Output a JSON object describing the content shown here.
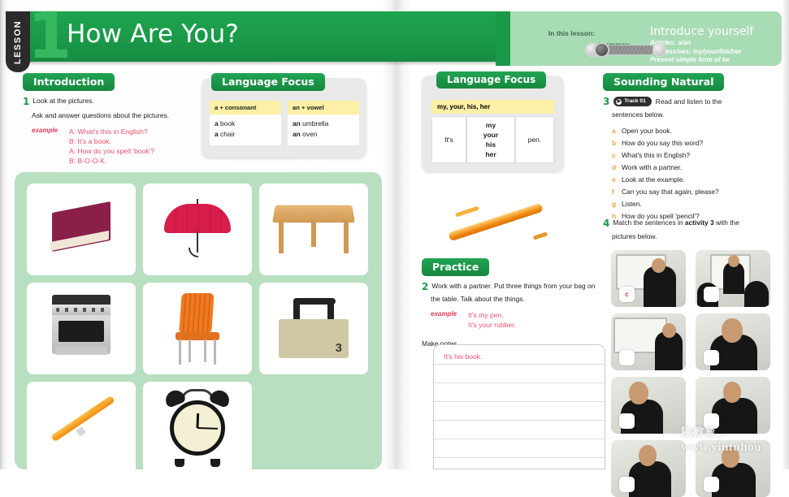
{
  "header": {
    "lesson_tab_label": "LESSON",
    "lesson_number": "1",
    "title": "How Are You?"
  },
  "info_box": {
    "in_this_lesson_label": "In this lesson:",
    "in_this_lesson_value": "Introduce yourself",
    "grammar_label": "Grammar:",
    "grammar_items": [
      "Articles: a/an",
      "Possessives: my/your/his/her",
      "Present simple form of be"
    ]
  },
  "introduction": {
    "heading": "Introduction",
    "number": "1",
    "line1": "Look at the pictures.",
    "line2": "Ask and answer questions about the pictures.",
    "example_label": "example",
    "dialog": [
      "A: What's this in English?",
      "B: It's a book.",
      "A: How do you spell 'book'?",
      "B: B-O-O-K."
    ]
  },
  "language_focus_1": {
    "heading": "Language Focus",
    "columns": [
      {
        "header": "a + consonant",
        "items": [
          {
            "article": "a",
            "word": "book"
          },
          {
            "article": "a",
            "word": "chair"
          }
        ]
      },
      {
        "header": "an + vowel",
        "items": [
          {
            "article": "an",
            "word": "umbrella"
          },
          {
            "article": "an",
            "word": "oven"
          }
        ]
      }
    ]
  },
  "pictures": [
    {
      "name": "book"
    },
    {
      "name": "umbrella"
    },
    {
      "name": "table"
    },
    {
      "name": "oven"
    },
    {
      "name": "chair"
    },
    {
      "name": "bag",
      "number": "3"
    },
    {
      "name": "pen"
    },
    {
      "name": "clock"
    }
  ],
  "language_focus_2": {
    "heading": "Language Focus",
    "table_header": "my, your, his, her",
    "subject": "It's",
    "possessives": [
      "my",
      "your",
      "his",
      "her"
    ],
    "object": "pen."
  },
  "practice": {
    "heading": "Practice",
    "number": "2",
    "line1": "Work with a partner. Put three things from your bag on",
    "line2": "the table. Talk about the things.",
    "example_label": "example",
    "examples": [
      "It's my pen.",
      "It's your rubber."
    ],
    "make_notes_label": "Make notes.",
    "note_written": "It's his book."
  },
  "sounding_natural": {
    "heading": "Sounding Natural",
    "number": "3",
    "track_label": "Track 01",
    "instruction_line1": "Read and listen to the",
    "instruction_line2": "sentences below.",
    "sentences": [
      {
        "letter": "a",
        "text": "Open your book."
      },
      {
        "letter": "b",
        "text": "How do you say this word?"
      },
      {
        "letter": "c",
        "text": "What's this in English?"
      },
      {
        "letter": "d",
        "text": "Work with a partner."
      },
      {
        "letter": "e",
        "text": "Look at the example."
      },
      {
        "letter": "f",
        "text": "Can you say that again, please?"
      },
      {
        "letter": "g",
        "text": "Listen."
      },
      {
        "letter": "h",
        "text": "How do you spell 'pencil'?"
      }
    ]
  },
  "activity4": {
    "number": "4",
    "line1_pre": "Match the sentences in ",
    "line1_bold": "activity 3",
    "line1_post": " with the",
    "line2": "pictures below.",
    "photos": [
      {
        "answer": "c"
      },
      {
        "answer": ""
      },
      {
        "answer": ""
      },
      {
        "answer": ""
      },
      {
        "answer": ""
      },
      {
        "answer": ""
      },
      {
        "answer": ""
      },
      {
        "answer": ""
      }
    ]
  },
  "watermark": {
    "chinese": "陕教育...",
    "url": "www.yinfuhou"
  },
  "colors": {
    "brand_green": "#1a9a49",
    "light_green_panel": "#b8dfc0",
    "info_green": "#a8dcb4",
    "yellow_header": "#fbf0a6",
    "example_pink": "#e8506e",
    "letter_orange": "#e8a33a"
  }
}
